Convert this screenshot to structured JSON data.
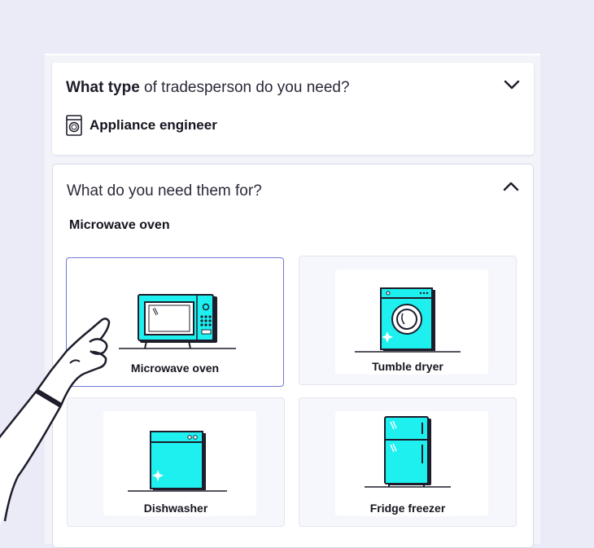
{
  "trade_question": {
    "bold": "What type",
    "rest": " of tradesperson do you need?",
    "answer": "Appliance engineer",
    "answer_icon": "washing-machine-icon",
    "toggle_icon": "chevron-down-icon"
  },
  "need_question": {
    "text": "What do you need them for?",
    "toggle_icon": "chevron-up-icon",
    "selected": "Microwave oven"
  },
  "options": [
    {
      "label": "Microwave oven",
      "icon": "microwave-icon",
      "selected": true
    },
    {
      "label": "Tumble dryer",
      "icon": "tumble-dryer-icon",
      "selected": false
    },
    {
      "label": "Dishwasher",
      "icon": "dishwasher-icon",
      "selected": false
    },
    {
      "label": "Fridge freezer",
      "icon": "fridge-freezer-icon",
      "selected": false
    }
  ],
  "colors": {
    "background": "#ebebf8",
    "accent_cyan": "#1ef0f0",
    "selected_border": "#6f7ad6",
    "text": "#15151f"
  }
}
